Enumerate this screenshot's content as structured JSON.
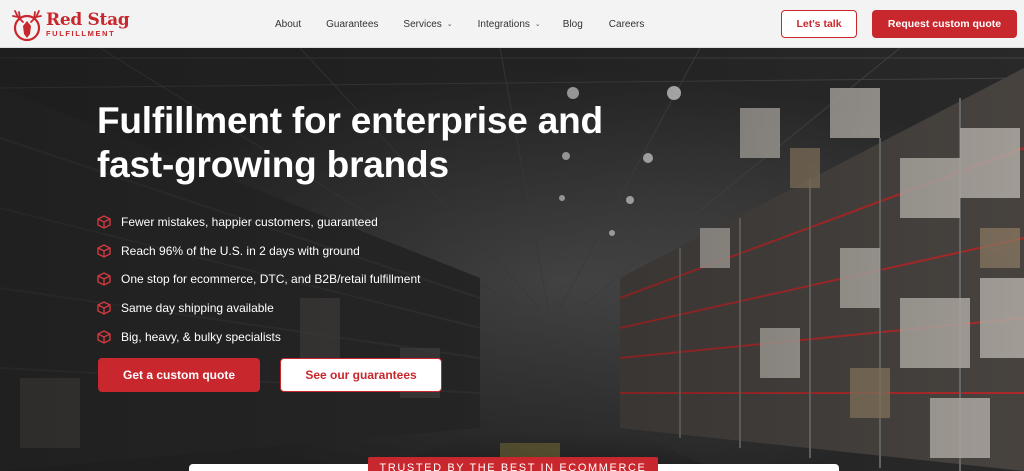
{
  "brand": {
    "name": "Red Stag",
    "tagline": "FULFILLMENT",
    "color": "#c8272d"
  },
  "nav": {
    "items": [
      {
        "label": "About",
        "has_dropdown": false
      },
      {
        "label": "Guarantees",
        "has_dropdown": false
      },
      {
        "label": "Services",
        "has_dropdown": true
      },
      {
        "label": "Integrations",
        "has_dropdown": true
      },
      {
        "label": "Blog",
        "has_dropdown": false
      },
      {
        "label": "Careers",
        "has_dropdown": false
      }
    ],
    "dropdown_icon": "chevron-down-icon"
  },
  "header_buttons": {
    "talk_label": "Let's talk",
    "request_label": "Request custom quote"
  },
  "hero": {
    "title_line1": "Fulfillment for enterprise and",
    "title_line2": "fast-growing brands",
    "bullet_icon": "box-icon",
    "bullets": [
      "Fewer mistakes, happier customers, guaranteed",
      "Reach 96% of the U.S. in 2 days with ground",
      "One stop for ecommerce, DTC, and B2B/retail fulfillment",
      "Same day shipping available",
      "Big, heavy, & bulky specialists"
    ],
    "primary_cta": "Get a custom quote",
    "secondary_cta": "See our guarantees"
  },
  "trusted": {
    "label": "TRUSTED BY THE BEST IN ECOMMERCE"
  }
}
